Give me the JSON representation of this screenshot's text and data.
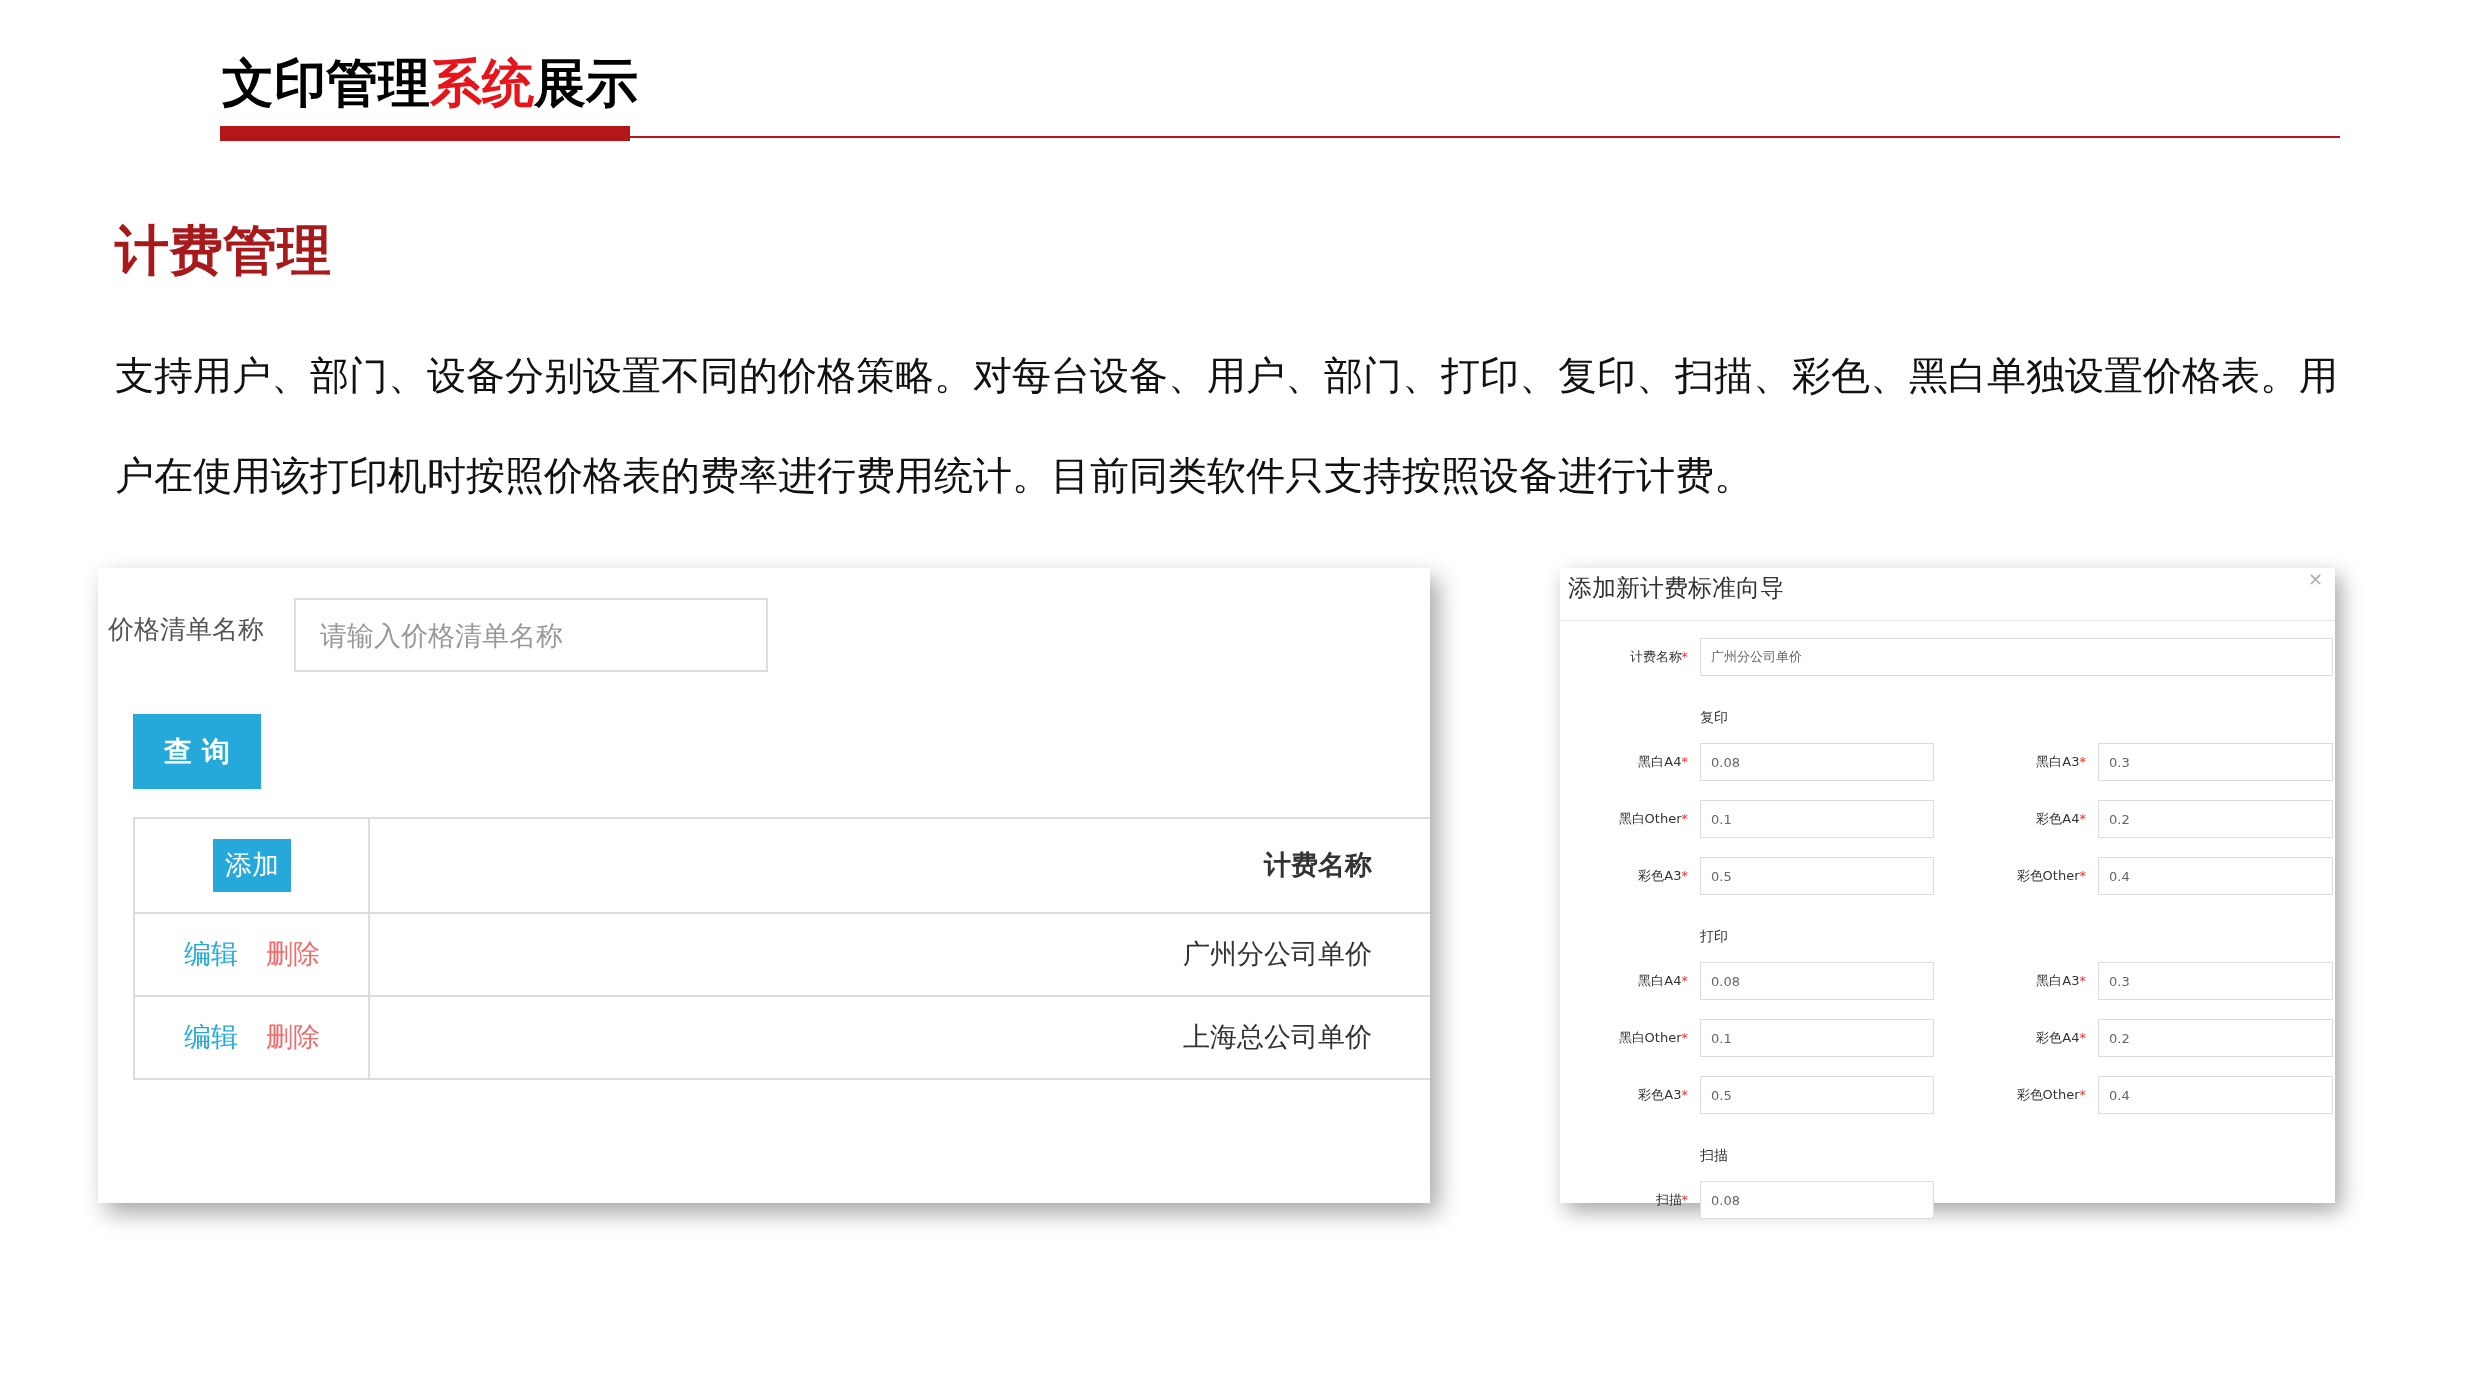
{
  "title_parts": [
    {
      "text": "文印管理",
      "highlight": false
    },
    {
      "text": "系统",
      "highlight": true
    },
    {
      "text": "展示",
      "highlight": false
    }
  ],
  "section_heading": "计费管理",
  "description": "支持用户、部门、设备分别设置不同的价格策略。对每台设备、用户、部门、打印、复印、扫描、彩色、黑白单独设置价格表。用户在使用该打印机时按照价格表的费率进行费用统计。目前同类软件只支持按照设备进行计费。",
  "price_list": {
    "filter_label": "价格清单名称",
    "filter_placeholder": "请输入价格清单名称",
    "search_button": "查 询",
    "add_button": "添加",
    "column_header": "计费名称",
    "rows": [
      {
        "edit": "编辑",
        "delete": "删除",
        "name": "广州分公司单价"
      },
      {
        "edit": "编辑",
        "delete": "删除",
        "name": "上海总公司单价"
      }
    ]
  },
  "dialog": {
    "title": "添加新计费标准向导",
    "close": "×",
    "name_label": "计费名称",
    "name_required": "*",
    "name_value": "广州分公司单价",
    "sections": [
      {
        "heading": "复印",
        "fields": [
          {
            "label": "黑白A4",
            "required": "*",
            "value": "0.08"
          },
          {
            "label": "黑白A3",
            "required": "*",
            "value": "0.3"
          },
          {
            "label": "黑白Other",
            "required": "*",
            "value": "0.1"
          },
          {
            "label": "彩色A4",
            "required": "*",
            "value": "0.2"
          },
          {
            "label": "彩色A3",
            "required": "*",
            "value": "0.5"
          },
          {
            "label": "彩色Other",
            "required": "*",
            "value": "0.4"
          }
        ]
      },
      {
        "heading": "打印",
        "fields": [
          {
            "label": "黑白A4",
            "required": "*",
            "value": "0.08"
          },
          {
            "label": "黑白A3",
            "required": "*",
            "value": "0.3"
          },
          {
            "label": "黑白Other",
            "required": "*",
            "value": "0.1"
          },
          {
            "label": "彩色A4",
            "required": "*",
            "value": "0.2"
          },
          {
            "label": "彩色A3",
            "required": "*",
            "value": "0.5"
          },
          {
            "label": "彩色Other",
            "required": "*",
            "value": "0.4"
          }
        ]
      },
      {
        "heading": "扫描",
        "fields": [
          {
            "label": "扫描",
            "required": "*",
            "value": "0.08"
          }
        ]
      }
    ]
  }
}
